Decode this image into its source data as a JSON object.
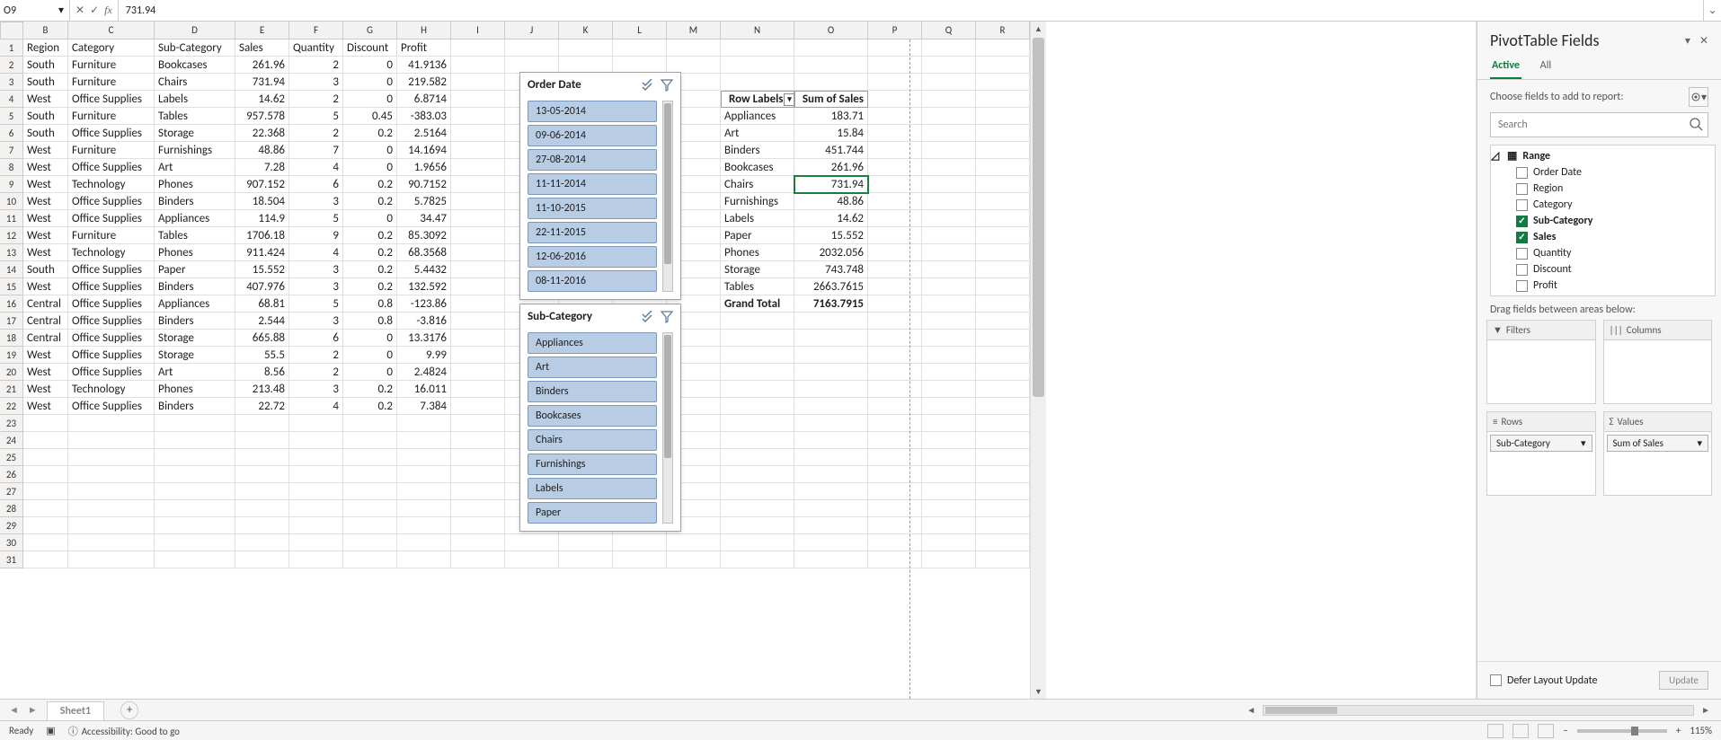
{
  "formula_bar": {
    "cell_ref": "O9",
    "formula": "731.94"
  },
  "columns": [
    "B",
    "C",
    "D",
    "E",
    "F",
    "G",
    "H",
    "I",
    "J",
    "K",
    "L",
    "M",
    "N",
    "O",
    "P",
    "Q",
    "R"
  ],
  "row_numbers": [
    1,
    2,
    3,
    4,
    5,
    6,
    7,
    8,
    9,
    10,
    11,
    12,
    13,
    14,
    15,
    16,
    17,
    18,
    19,
    20,
    21,
    22,
    23,
    24,
    25,
    26,
    27,
    28,
    29,
    30,
    31
  ],
  "headers": [
    "Region",
    "Category",
    "Sub-Category",
    "Sales",
    "Quantity",
    "Discount",
    "Profit"
  ],
  "data_rows": [
    [
      "South",
      "Furniture",
      "Bookcases",
      "261.96",
      "2",
      "0",
      "41.9136"
    ],
    [
      "South",
      "Furniture",
      "Chairs",
      "731.94",
      "3",
      "0",
      "219.582"
    ],
    [
      "West",
      "Office Supplies",
      "Labels",
      "14.62",
      "2",
      "0",
      "6.8714"
    ],
    [
      "South",
      "Furniture",
      "Tables",
      "957.578",
      "5",
      "0.45",
      "-383.03"
    ],
    [
      "South",
      "Office Supplies",
      "Storage",
      "22.368",
      "2",
      "0.2",
      "2.5164"
    ],
    [
      "West",
      "Furniture",
      "Furnishings",
      "48.86",
      "7",
      "0",
      "14.1694"
    ],
    [
      "West",
      "Office Supplies",
      "Art",
      "7.28",
      "4",
      "0",
      "1.9656"
    ],
    [
      "West",
      "Technology",
      "Phones",
      "907.152",
      "6",
      "0.2",
      "90.7152"
    ],
    [
      "West",
      "Office Supplies",
      "Binders",
      "18.504",
      "3",
      "0.2",
      "5.7825"
    ],
    [
      "West",
      "Office Supplies",
      "Appliances",
      "114.9",
      "5",
      "0",
      "34.47"
    ],
    [
      "West",
      "Furniture",
      "Tables",
      "1706.18",
      "9",
      "0.2",
      "85.3092"
    ],
    [
      "West",
      "Technology",
      "Phones",
      "911.424",
      "4",
      "0.2",
      "68.3568"
    ],
    [
      "South",
      "Office Supplies",
      "Paper",
      "15.552",
      "3",
      "0.2",
      "5.4432"
    ],
    [
      "West",
      "Office Supplies",
      "Binders",
      "407.976",
      "3",
      "0.2",
      "132.592"
    ],
    [
      "Central",
      "Office Supplies",
      "Appliances",
      "68.81",
      "5",
      "0.8",
      "-123.86"
    ],
    [
      "Central",
      "Office Supplies",
      "Binders",
      "2.544",
      "3",
      "0.8",
      "-3.816"
    ],
    [
      "Central",
      "Office Supplies",
      "Storage",
      "665.88",
      "6",
      "0",
      "13.3176"
    ],
    [
      "West",
      "Office Supplies",
      "Storage",
      "55.5",
      "2",
      "0",
      "9.99"
    ],
    [
      "West",
      "Office Supplies",
      "Art",
      "8.56",
      "2",
      "0",
      "2.4824"
    ],
    [
      "West",
      "Technology",
      "Phones",
      "213.48",
      "3",
      "0.2",
      "16.011"
    ],
    [
      "West",
      "Office Supplies",
      "Binders",
      "22.72",
      "4",
      "0.2",
      "7.384"
    ]
  ],
  "pivot": {
    "row_header": "Row Labels",
    "value_header": "Sum of Sales",
    "rows": [
      [
        "Appliances",
        "183.71"
      ],
      [
        "Art",
        "15.84"
      ],
      [
        "Binders",
        "451.744"
      ],
      [
        "Bookcases",
        "261.96"
      ],
      [
        "Chairs",
        "731.94"
      ],
      [
        "Furnishings",
        "48.86"
      ],
      [
        "Labels",
        "14.62"
      ],
      [
        "Paper",
        "15.552"
      ],
      [
        "Phones",
        "2032.056"
      ],
      [
        "Storage",
        "743.748"
      ],
      [
        "Tables",
        "2663.7615"
      ]
    ],
    "grand_label": "Grand Total",
    "grand_value": "7163.7915"
  },
  "slicers": {
    "order_date": {
      "title": "Order Date",
      "items": [
        "13-05-2014",
        "09-06-2014",
        "27-08-2014",
        "11-11-2014",
        "11-10-2015",
        "22-11-2015",
        "12-06-2016",
        "08-11-2016"
      ]
    },
    "sub_cat": {
      "title": "Sub-Category",
      "items": [
        "Appliances",
        "Art",
        "Binders",
        "Bookcases",
        "Chairs",
        "Furnishings",
        "Labels",
        "Paper"
      ]
    }
  },
  "panel": {
    "title": "PivotTable Fields",
    "tabs": {
      "active": "Active",
      "all": "All"
    },
    "choose_label": "Choose fields to add to report:",
    "search_placeholder": "Search",
    "range_label": "Range",
    "fields": [
      {
        "name": "Order Date",
        "checked": false
      },
      {
        "name": "Region",
        "checked": false
      },
      {
        "name": "Category",
        "checked": false
      },
      {
        "name": "Sub-Category",
        "checked": true,
        "bold": true
      },
      {
        "name": "Sales",
        "checked": true,
        "bold": true
      },
      {
        "name": "Quantity",
        "checked": false
      },
      {
        "name": "Discount",
        "checked": false
      },
      {
        "name": "Profit",
        "checked": false
      }
    ],
    "drag_label": "Drag fields between areas below:",
    "areas": {
      "filters": "Filters",
      "columns": "Columns",
      "rows": "Rows",
      "values": "Values",
      "row_item": "Sub-Category",
      "value_item": "Sum of Sales"
    },
    "defer_label": "Defer Layout Update",
    "update_btn": "Update"
  },
  "footer": {
    "sheet_name": "Sheet1",
    "ready": "Ready",
    "accessibility": "Accessibility: Good to go",
    "zoom": "115%"
  }
}
